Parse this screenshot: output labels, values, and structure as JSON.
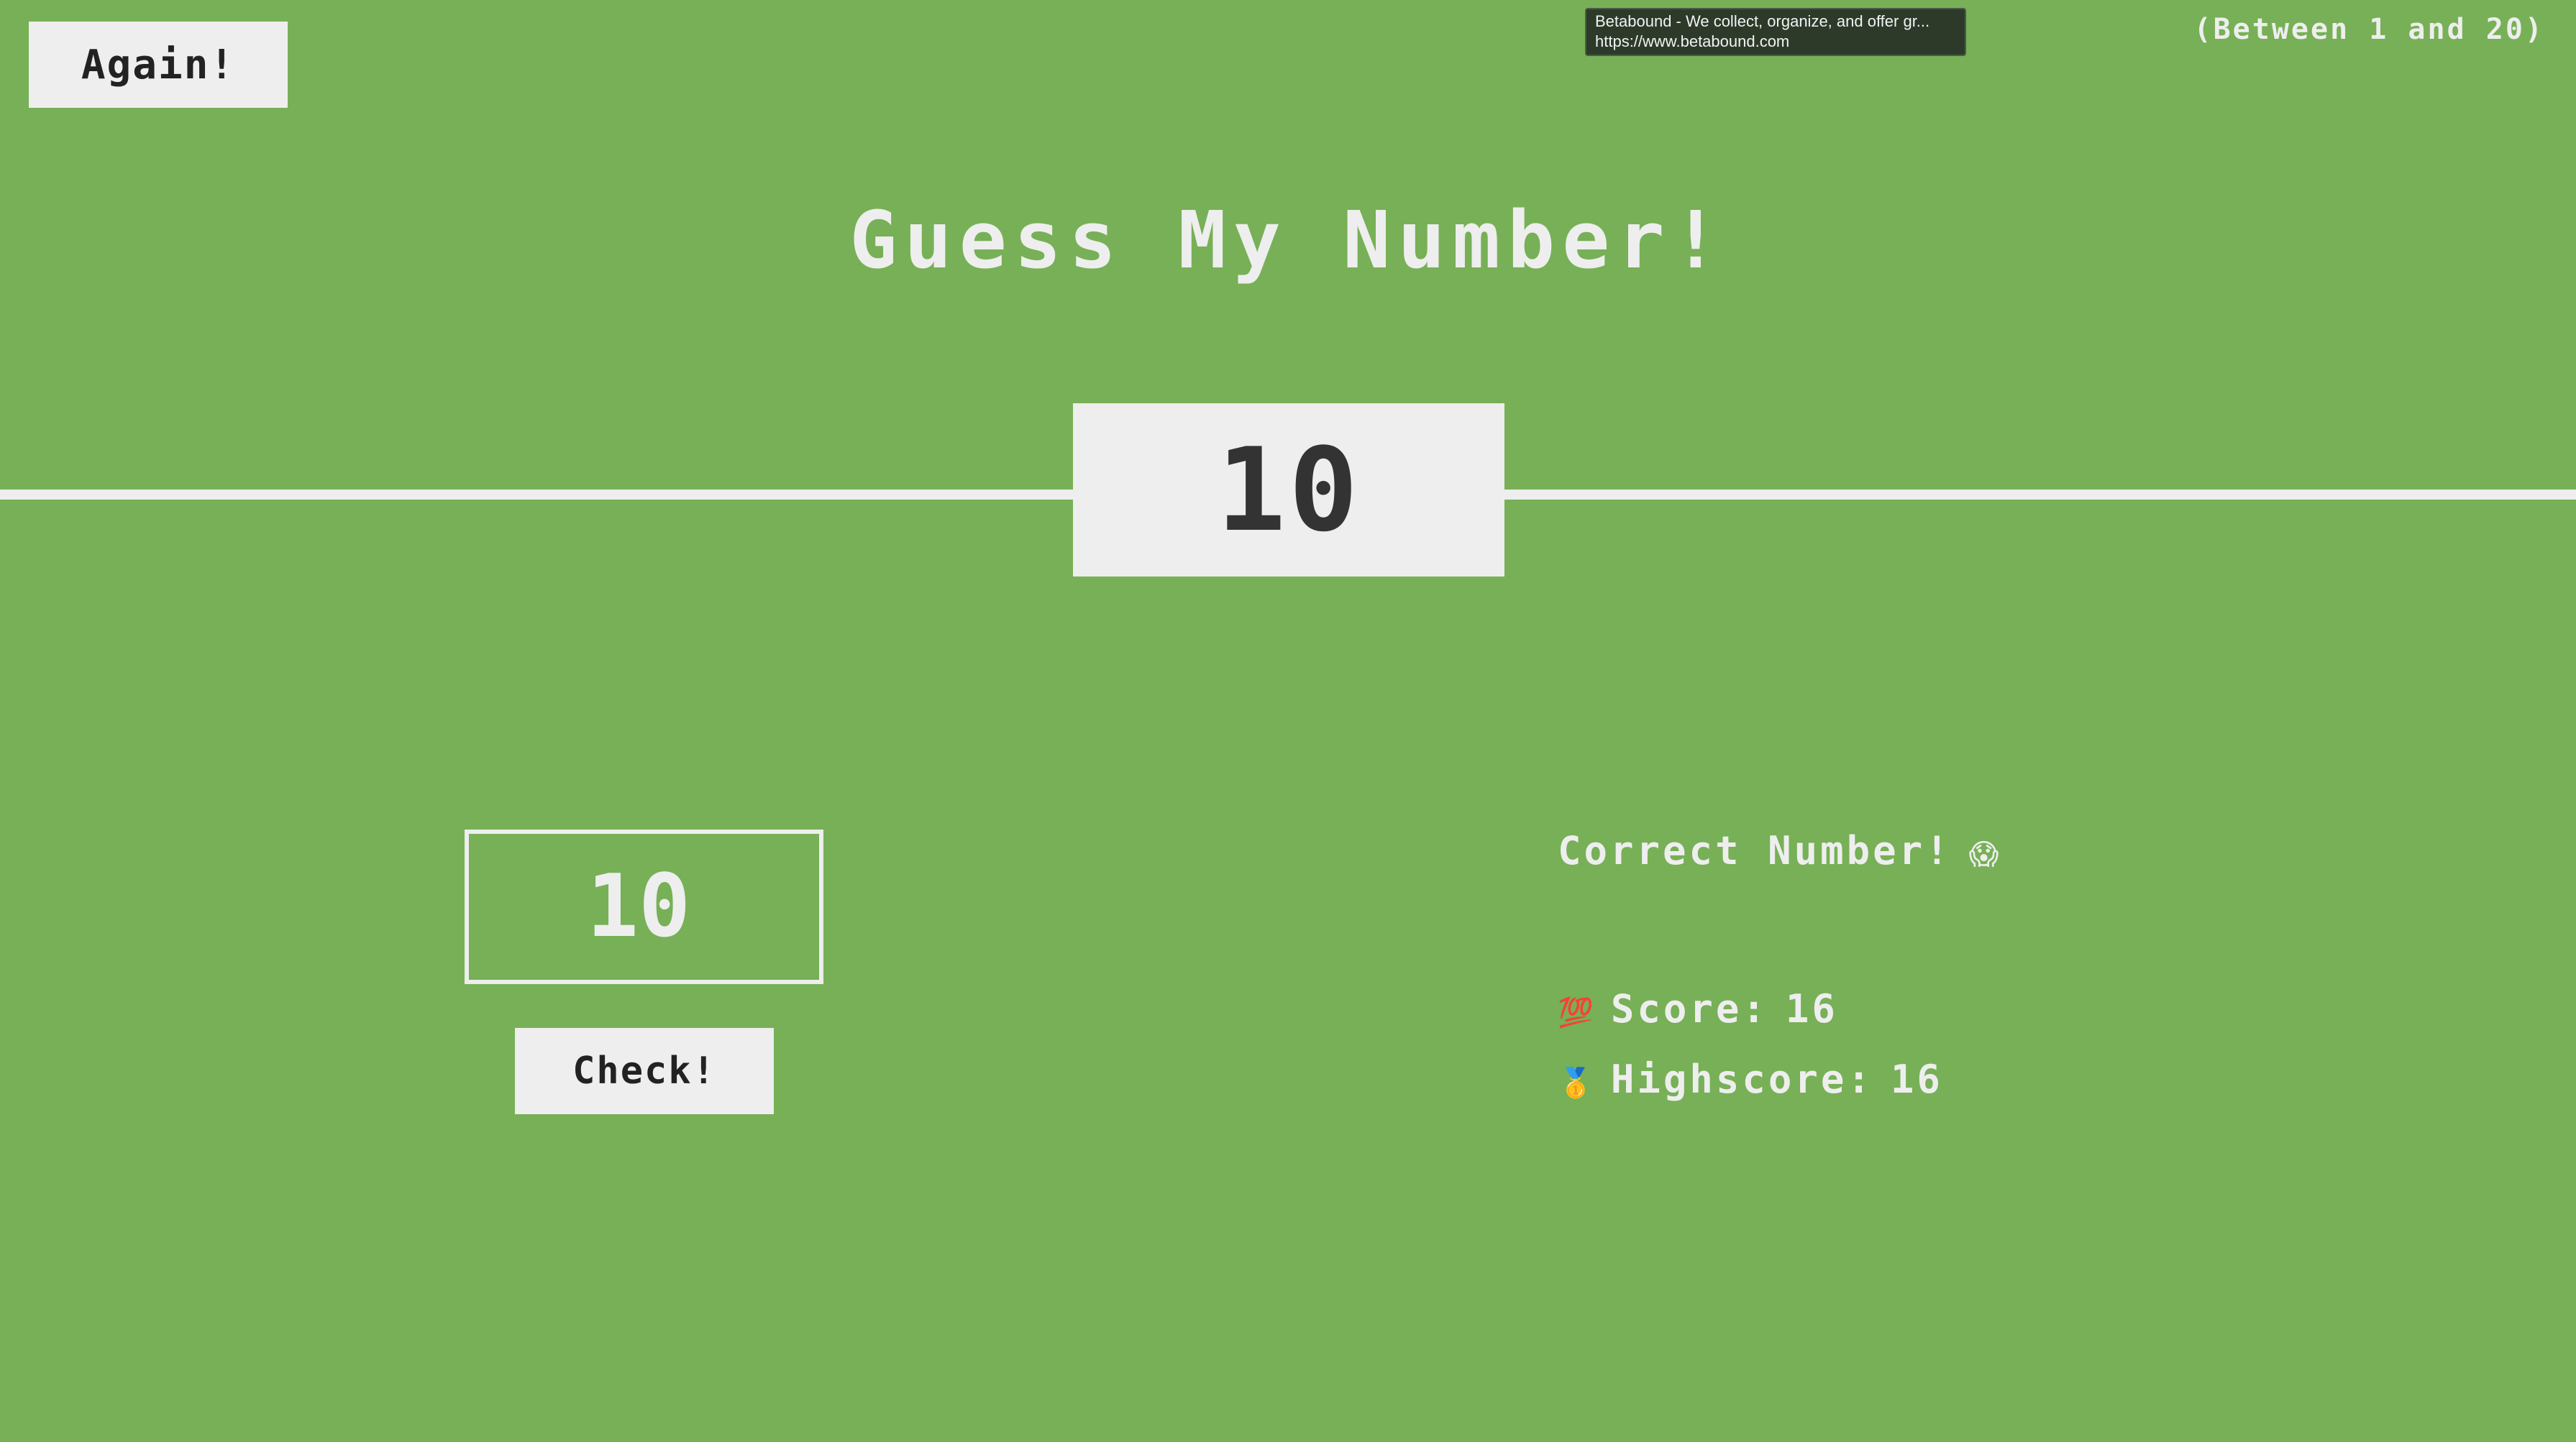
{
  "header": {
    "again_label": "Again!",
    "range_text": "(Between 1 and 20)"
  },
  "tooltip": {
    "title": "Betabound - We collect, organize, and offer gr...",
    "url": "https://www.betabound.com"
  },
  "game": {
    "title": "Guess My Number!",
    "secret_number": "10",
    "guess_value": "10",
    "check_label": "Check!",
    "message": "Correct Number!",
    "message_emoji": "😱",
    "score_emoji": "💯",
    "score_label": "Score:",
    "score_value": "16",
    "highscore_emoji": "🥇",
    "highscore_label": "Highscore:",
    "highscore_value": "16"
  },
  "colors": {
    "background": "#77b056",
    "foreground": "#eeeeee",
    "dark_text": "#333333"
  }
}
